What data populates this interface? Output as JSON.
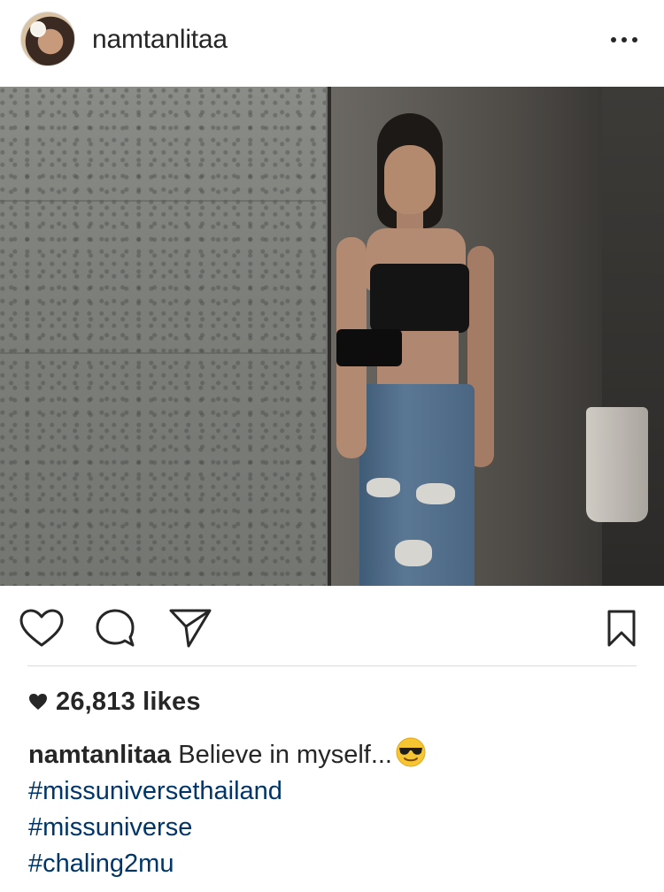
{
  "header": {
    "username": "namtanlitaa",
    "avatar_icon": "profile-photo",
    "more_icon": "more-horizontal-icon"
  },
  "post": {
    "image_description": "mirror-selfie-photo"
  },
  "actions": {
    "like_icon": "heart-outline-icon",
    "comment_icon": "comment-bubble-icon",
    "share_icon": "direct-share-icon",
    "save_icon": "bookmark-icon"
  },
  "likes": {
    "icon": "heart-filled-icon",
    "text": "26,813 likes"
  },
  "caption": {
    "username": "namtanlitaa",
    "text": "Believe in myself...",
    "emoji_icon": "smiling-face-with-sunglasses-emoji",
    "hashtags": [
      "#missuniversethailand",
      "#missuniverse",
      "#chaling2mu"
    ]
  },
  "colors": {
    "text": "#262626",
    "hashtag": "#003569",
    "divider": "#dbdbdb"
  }
}
